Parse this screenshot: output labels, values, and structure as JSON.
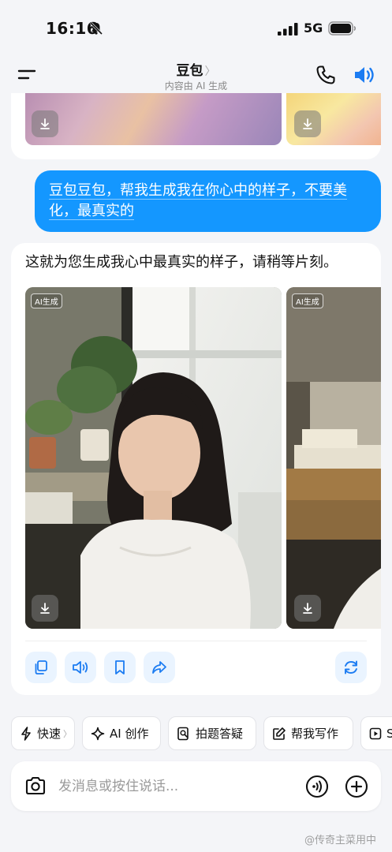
{
  "status_bar": {
    "time": "16:16",
    "network": "5G",
    "icons": [
      "bell-muted-icon",
      "signal-icon",
      "battery-icon"
    ]
  },
  "header": {
    "title": "豆包",
    "title_chevron": "〉",
    "subtitle": "内容由 AI 生成",
    "icons": [
      "menu-icon",
      "phone-icon",
      "speaker-icon"
    ]
  },
  "messages": {
    "user_text": "豆包豆包，帮我生成我在你心中的样子，不要美化，最真实的",
    "ai_text": "这就为您生成我心中最真实的样子，请稍等片刻。",
    "ai_badge": "AI生成",
    "actions": [
      "copy-icon",
      "read-aloud-icon",
      "bookmark-icon",
      "share-icon",
      "regenerate-icon"
    ]
  },
  "quick_actions": [
    {
      "label": "快速",
      "icon": "lightning-icon",
      "chevron": "〉"
    },
    {
      "label": "AI 创作",
      "icon": "sparkle-icon"
    },
    {
      "label": "拍题答疑",
      "icon": "photo-question-icon"
    },
    {
      "label": "帮我写作",
      "icon": "pen-icon"
    },
    {
      "label": "S",
      "icon": "video-icon"
    }
  ],
  "composer": {
    "placeholder": "发消息或按住说话..."
  },
  "watermark": "@传奇主菜用中",
  "colors": {
    "accent": "#1497ff",
    "action_bg": "#eaf4ff",
    "page_bg": "#f4f5f8"
  }
}
